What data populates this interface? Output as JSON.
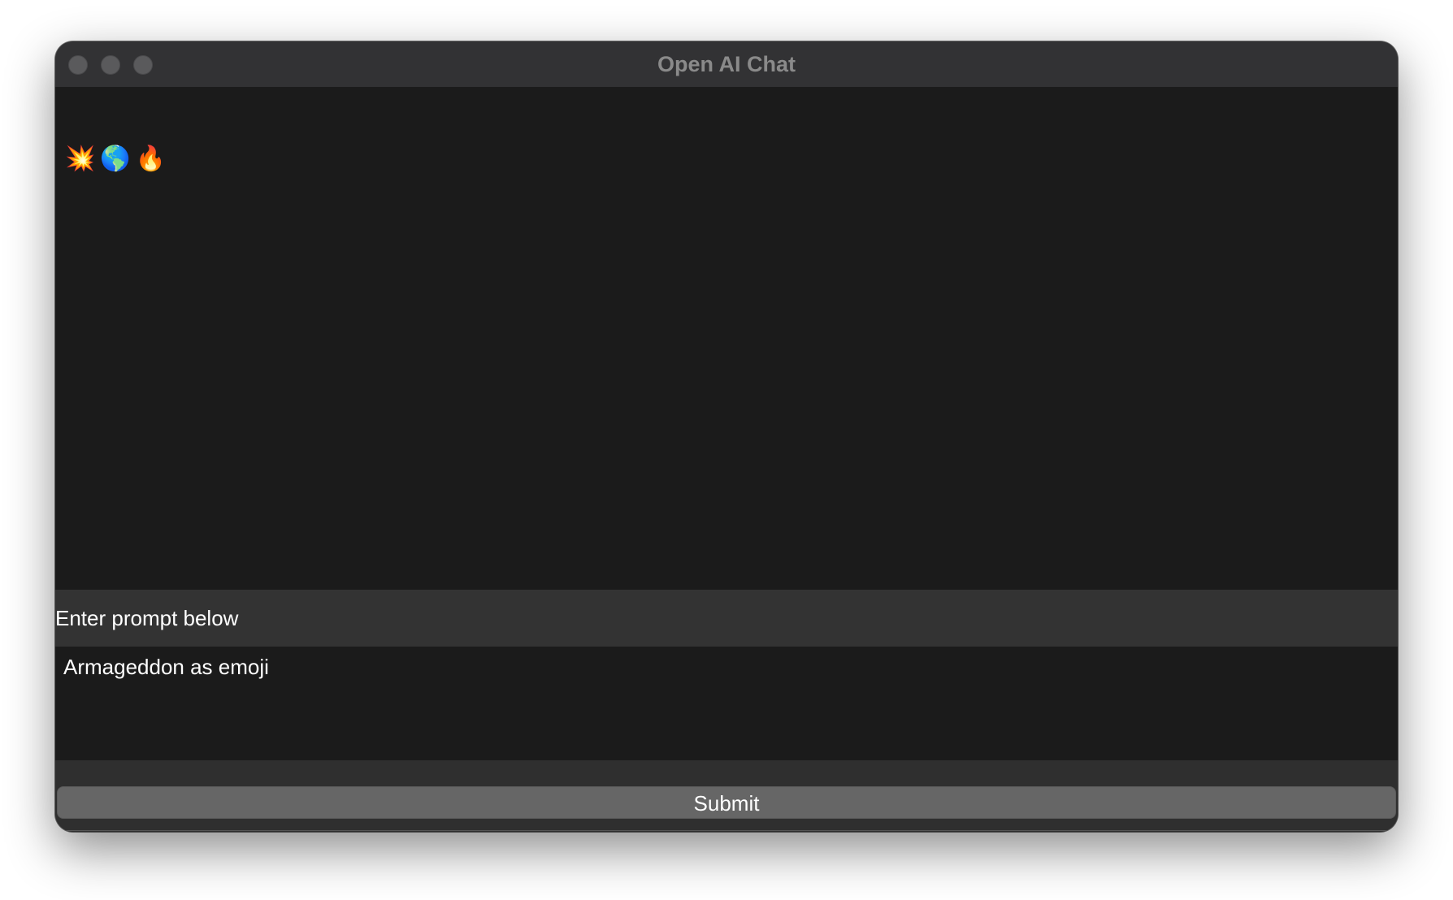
{
  "window": {
    "title": "Open AI Chat"
  },
  "output": {
    "text": "💥🌎🔥"
  },
  "prompt": {
    "label": "Enter prompt below",
    "value": "Armageddon as emoji"
  },
  "actions": {
    "submit_label": "Submit"
  }
}
